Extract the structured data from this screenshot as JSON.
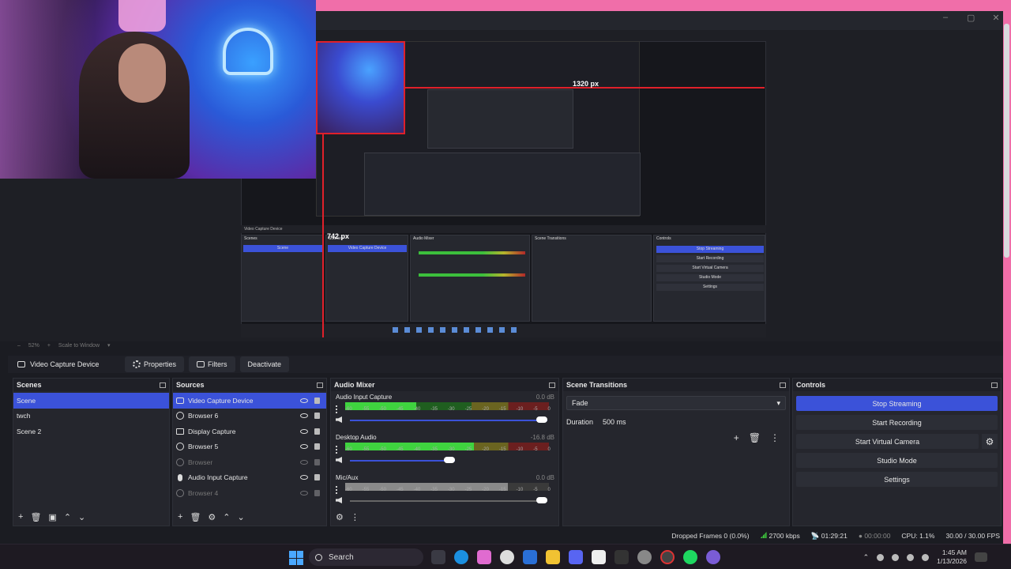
{
  "window": {
    "controls": [
      "minimize",
      "maximize",
      "close"
    ]
  },
  "preview": {
    "measure_width": "1320 px",
    "measure_height": "742 px",
    "zoom": "52%",
    "scale_label": "Scale to Window"
  },
  "context": {
    "source_name": "Video Capture Device",
    "properties_label": "Properties",
    "filters_label": "Filters",
    "deactivate_label": "Deactivate"
  },
  "scenes": {
    "title": "Scenes",
    "items": [
      "Scene",
      "twch",
      "Scene 2"
    ]
  },
  "sources": {
    "title": "Sources",
    "items": [
      {
        "label": "Video Capture Device",
        "icon": "camera-icon"
      },
      {
        "label": "Browser 6",
        "icon": "browser-icon"
      },
      {
        "label": "Display Capture",
        "icon": "display-icon"
      },
      {
        "label": "Browser 5",
        "icon": "browser-icon"
      },
      {
        "label": "Browser",
        "icon": "browser-icon"
      },
      {
        "label": "Audio Input Capture",
        "icon": "mic-icon"
      },
      {
        "label": "Browser 4",
        "icon": "browser-icon"
      }
    ]
  },
  "mixer": {
    "title": "Audio Mixer",
    "ticks": [
      "-60",
      "-55",
      "-50",
      "-45",
      "-40",
      "-35",
      "-30",
      "-25",
      "-20",
      "-15",
      "-10",
      "-5",
      "0"
    ],
    "channels": [
      {
        "name": "Audio Input Capture",
        "db": "0.0 dB",
        "level": 0.35,
        "volume": 1.0
      },
      {
        "name": "Desktop Audio",
        "db": "-16.8 dB",
        "level": 0.63,
        "volume": 0.53
      },
      {
        "name": "Mic/Aux",
        "db": "0.0 dB",
        "level": 0.0,
        "volume": 1.0
      }
    ]
  },
  "transitions": {
    "title": "Scene Transitions",
    "selected": "Fade",
    "duration_label": "Duration",
    "duration_value": "500 ms"
  },
  "controls": {
    "title": "Controls",
    "stop_streaming": "Stop Streaming",
    "start_recording": "Start Recording",
    "start_virtual_camera": "Start Virtual Camera",
    "studio_mode": "Studio Mode",
    "settings": "Settings"
  },
  "status": {
    "dropped_frames": "Dropped Frames 0 (0.0%)",
    "bitrate": "2700 kbps",
    "stream_time": "01:29:21",
    "record_time": "00:00:00",
    "cpu": "CPU: 1.1%",
    "fps": "30.00 / 30.00 FPS"
  },
  "taskbar": {
    "search_label": "Search",
    "time": "1:45 AM",
    "date": "1/13/2026"
  },
  "colors": {
    "accent": "#3b52d9",
    "pink": "#f06ea9",
    "meter_green": "#3fd33f"
  }
}
